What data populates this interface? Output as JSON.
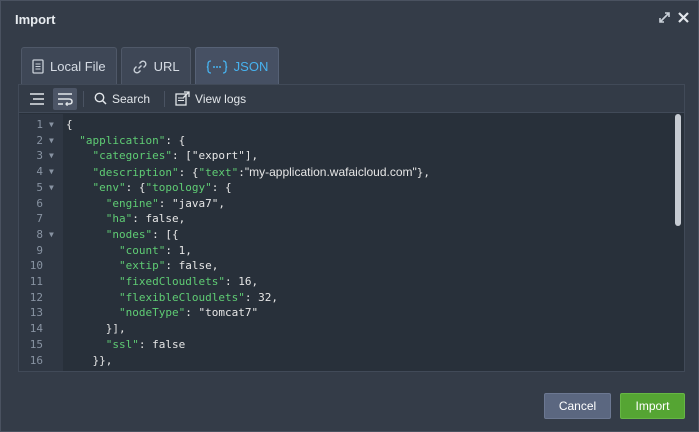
{
  "dialog": {
    "title": "Import"
  },
  "tabs": [
    {
      "label": "Local File",
      "icon": "document-icon",
      "active": false
    },
    {
      "label": "URL",
      "icon": "link-icon",
      "active": false
    },
    {
      "label": "JSON",
      "icon": "json-braces-icon",
      "active": true
    }
  ],
  "toolbar": {
    "search_label": "Search",
    "viewlogs_label": "View logs"
  },
  "code_lines": [
    {
      "n": "1",
      "fold": true,
      "html": "{"
    },
    {
      "n": "2",
      "fold": true,
      "html": "  <span class='k'>\"application\"</span>: {"
    },
    {
      "n": "3",
      "fold": true,
      "html": "    <span class='k'>\"categories\"</span>: [\"export\"],"
    },
    {
      "n": "4",
      "fold": true,
      "html": "    <span class='k'>\"description\"</span>: {<span class='k'>\"text\"</span>:<span class='sans'>\"my-application.wafaicloud.com\"</span>},"
    },
    {
      "n": "5",
      "fold": true,
      "html": "    <span class='k'>\"env\"</span>: {<span class='k'>\"topology\"</span>: {"
    },
    {
      "n": "6",
      "fold": false,
      "html": "      <span class='k'>\"engine\"</span>: \"java7\","
    },
    {
      "n": "7",
      "fold": false,
      "html": "      <span class='k'>\"ha\"</span>: false,"
    },
    {
      "n": "8",
      "fold": true,
      "html": "      <span class='k'>\"nodes\"</span>: [{"
    },
    {
      "n": "9",
      "fold": false,
      "html": "        <span class='k'>\"count\"</span>: 1,"
    },
    {
      "n": "10",
      "fold": false,
      "html": "        <span class='k'>\"extip\"</span>: false,"
    },
    {
      "n": "11",
      "fold": false,
      "html": "        <span class='k'>\"fixedCloudlets\"</span>: 16,"
    },
    {
      "n": "12",
      "fold": false,
      "html": "        <span class='k'>\"flexibleCloudlets\"</span>: 32,"
    },
    {
      "n": "13",
      "fold": false,
      "html": "        <span class='k'>\"nodeType\"</span>: \"tomcat7\""
    },
    {
      "n": "14",
      "fold": false,
      "html": "      }],"
    },
    {
      "n": "15",
      "fold": false,
      "html": "      <span class='k'>\"ssl\"</span>: false"
    },
    {
      "n": "16",
      "fold": false,
      "html": "    }},"
    }
  ],
  "footer": {
    "cancel_label": "Cancel",
    "import_label": "Import"
  },
  "colors": {
    "accent": "#47b2ef",
    "json_key": "#5fcc74",
    "import_button": "#55a533",
    "cancel_button": "#5b6780"
  }
}
